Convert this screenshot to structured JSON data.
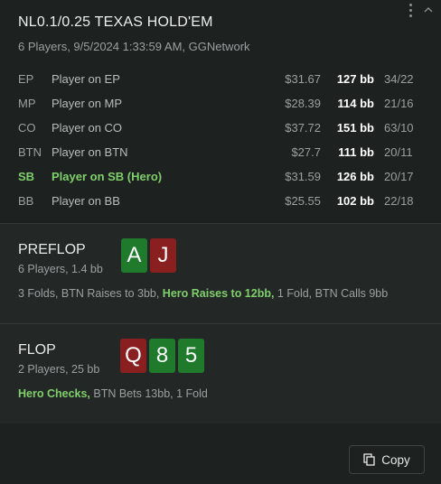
{
  "header": {
    "title": "NL0.1/0.25 TEXAS HOLD'EM",
    "subtitle": "6 Players, 9/5/2024 1:33:59 AM, GGNetwork"
  },
  "players": [
    {
      "pos": "EP",
      "name": "Player on EP",
      "stack": "$31.67",
      "bb": "127 bb",
      "stats": "34/22",
      "hero": false
    },
    {
      "pos": "MP",
      "name": "Player on MP",
      "stack": "$28.39",
      "bb": "114 bb",
      "stats": "21/16",
      "hero": false
    },
    {
      "pos": "CO",
      "name": "Player on CO",
      "stack": "$37.72",
      "bb": "151 bb",
      "stats": "63/10",
      "hero": false
    },
    {
      "pos": "BTN",
      "name": "Player on BTN",
      "stack": "$27.7",
      "bb": "111 bb",
      "stats": "20/11",
      "hero": false
    },
    {
      "pos": "SB",
      "name": "Player on SB (Hero)",
      "stack": "$31.59",
      "bb": "126 bb",
      "stats": "20/17",
      "hero": true
    },
    {
      "pos": "BB",
      "name": "Player on BB",
      "stack": "$25.55",
      "bb": "102 bb",
      "stats": "22/18",
      "hero": false
    }
  ],
  "preflop": {
    "street": "PREFLOP",
    "sub": "6 Players, 1.4 bb",
    "cards": [
      {
        "rank": "A",
        "color": "green"
      },
      {
        "rank": "J",
        "color": "red"
      }
    ],
    "action_a": "3 Folds, BTN Raises to 3bb, ",
    "action_hero": "Hero Raises to 12bb,",
    "action_b": " 1 Fold, BTN Calls 9bb"
  },
  "flop": {
    "street": "FLOP",
    "sub": "2 Players, 25 bb",
    "cards": [
      {
        "rank": "Q",
        "color": "red"
      },
      {
        "rank": "8",
        "color": "green"
      },
      {
        "rank": "5",
        "color": "green"
      }
    ],
    "action_hero": "Hero Checks,",
    "action_b": " BTN Bets 13bb, 1 Fold"
  },
  "footer": {
    "copy_label": "Copy"
  },
  "colors": {
    "hero_green": "#7fcf6a",
    "card_green": "#1f7a2c",
    "card_red": "#8a1f1f"
  },
  "icons": [
    "more-vert-icon",
    "collapse-icon",
    "copy-icon"
  ]
}
